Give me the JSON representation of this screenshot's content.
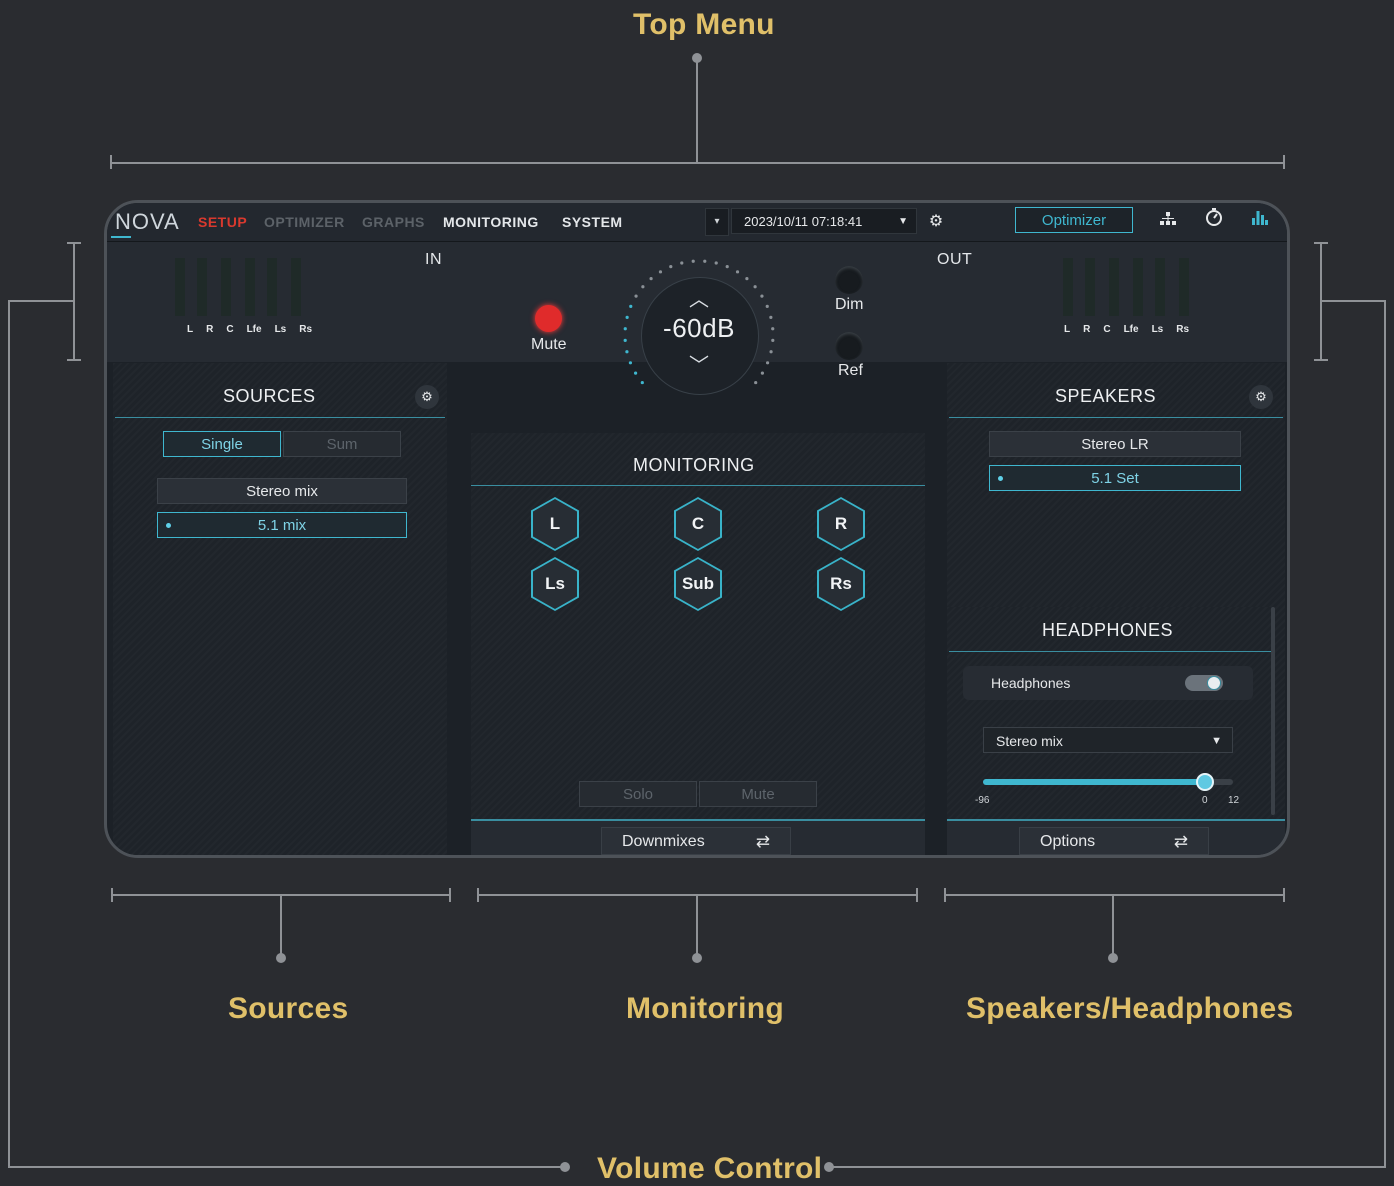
{
  "callouts": {
    "top_menu": "Top Menu",
    "sources": "Sources",
    "monitoring": "Monitoring",
    "speakers_headphones": "Speakers/Headphones",
    "volume_control": "Volume Control"
  },
  "app": {
    "logo": "NOVA",
    "tabs": [
      {
        "label": "SETUP",
        "state": "active"
      },
      {
        "label": "OPTIMIZER",
        "state": "disabled"
      },
      {
        "label": "GRAPHS",
        "state": "disabled"
      },
      {
        "label": "MONITORING",
        "state": "normal"
      },
      {
        "label": "SYSTEM",
        "state": "normal"
      }
    ],
    "datetime": "2023/10/11 07:18:41",
    "optimizer_button": "Optimizer",
    "icons": [
      "dropdown-icon",
      "settings-icon",
      "network-icon",
      "timer-icon",
      "level-meter-icon"
    ]
  },
  "header": {
    "in_label": "IN",
    "out_label": "OUT",
    "channels": [
      "L",
      "R",
      "C",
      "Lfe",
      "Ls",
      "Rs"
    ],
    "mute_label": "Mute",
    "dim_label": "Dim",
    "ref_label": "Ref",
    "volume": "-60dB"
  },
  "sources": {
    "title": "SOURCES",
    "mode_single": "Single",
    "mode_sum": "Sum",
    "items": [
      "Stereo mix",
      "5.1 mix"
    ],
    "selected": "5.1 mix"
  },
  "monitoring": {
    "title": "MONITORING",
    "speakers": [
      "L",
      "C",
      "R",
      "Ls",
      "Sub",
      "Rs"
    ],
    "solo_label": "Solo",
    "mute_label": "Mute",
    "downmixes_label": "Downmixes"
  },
  "speakers": {
    "title": "SPEAKERS",
    "items": [
      "Stereo LR",
      "5.1 Set"
    ],
    "selected": "5.1 Set"
  },
  "headphones": {
    "title": "HEADPHONES",
    "toggle_label": "Headphones",
    "toggle_on": true,
    "select_value": "Stereo mix",
    "slider_min": "-96",
    "slider_zero": "0",
    "slider_max": "12",
    "slider_value_db": 0,
    "options_label": "Options"
  },
  "colors": {
    "accent": "#3fb7cf",
    "callout": "#e0c069",
    "mute_red": "#e02b2b",
    "setup_tab_red": "#d9392e"
  }
}
